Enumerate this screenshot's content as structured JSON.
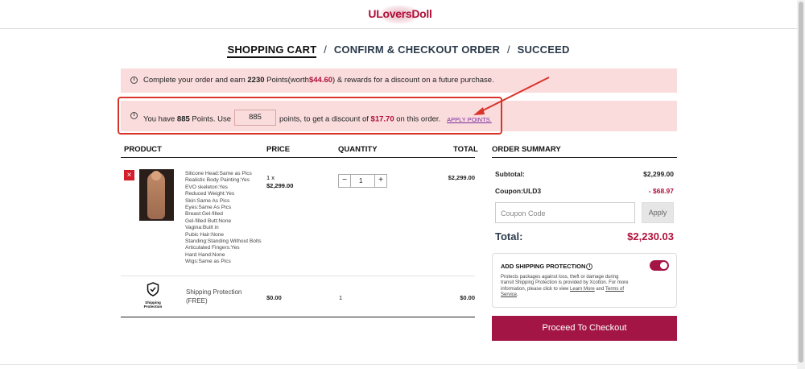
{
  "header": {
    "logo_text": "ULoversDoll"
  },
  "steps": {
    "active": "SHOPPING CART",
    "step2": "CONFIRM & CHECKOUT ORDER",
    "step3": "SUCCEED",
    "separator": "/"
  },
  "points_banner": {
    "prefix": "Complete your order and earn",
    "points": "2230",
    "points_word": "Points(worth",
    "worth": "$44.60",
    "suffix": ") & rewards for a discount on a future purchase."
  },
  "redeem_banner": {
    "prefix": "You have",
    "points": "885",
    "mid": "Points. Use",
    "input_value": "885",
    "after_input": "points, to get a discount of",
    "discount": "$17.70",
    "suffix": "on this order.",
    "apply_link": "APPLY POINTS."
  },
  "table": {
    "headers": {
      "product": "PRODUCT",
      "price": "PRICE",
      "quantity": "QUANTITY",
      "total": "TOTAL"
    },
    "item": {
      "remove_icon": "×",
      "options": [
        "Silicone Head:Same as Pics",
        "Realistic Body Painting:Yes",
        "EVO skeleton:Yes",
        "Reduced Weight:Yes",
        "Skin:Same As Pics",
        "Eyes:Same As Pics",
        "Breast:Gel-filled",
        "Gel-filled Butt:None",
        "Vagina:Built in",
        "Pubic Hair:None",
        "Standing:Standing Without Bolts",
        "Articulated Fingers:Yes",
        "Hard Hand:None",
        "Wigs:Same as Pics"
      ],
      "price_qty": "1 x",
      "price": "$2,299.00",
      "quantity": "1",
      "total": "$2,299.00",
      "minus": "−",
      "plus": "+"
    },
    "shipping": {
      "icon_label_1": "Shipping",
      "icon_label_2": "Protection",
      "name": "Shipping Protection",
      "free": "(FREE)",
      "price": "$0.00",
      "quantity": "1",
      "total": "$0.00"
    }
  },
  "summary": {
    "title": "ORDER SUMMARY",
    "subtotal_label": "Subtotal:",
    "subtotal": "$2,299.00",
    "coupon_label": "Coupon:ULD3",
    "coupon_value": "- $68.97",
    "coupon_placeholder": "Coupon Code",
    "apply_button": "Apply",
    "total_label": "Total:",
    "total": "$2,230.03",
    "shipping_protection": {
      "title": "ADD SHIPPING PROTECTION",
      "info_icon": "i",
      "description": "Protects packages against loss, theft or damage during transit Shipping Protection is provided by Xcotton. For more information, please click to view",
      "learn_more": "Learn More",
      "and": "and",
      "terms": "Terms of Service",
      "period": ".",
      "enabled": true
    },
    "checkout_button": "Proceed To Checkout"
  },
  "colors": {
    "brand": "#a31545",
    "banner": "#fadcdc",
    "highlight": "#d9342b",
    "link": "#7a2ea0"
  },
  "icons": {
    "info": "info-circle-icon",
    "remove": "close-icon",
    "shield": "shield-icon"
  }
}
